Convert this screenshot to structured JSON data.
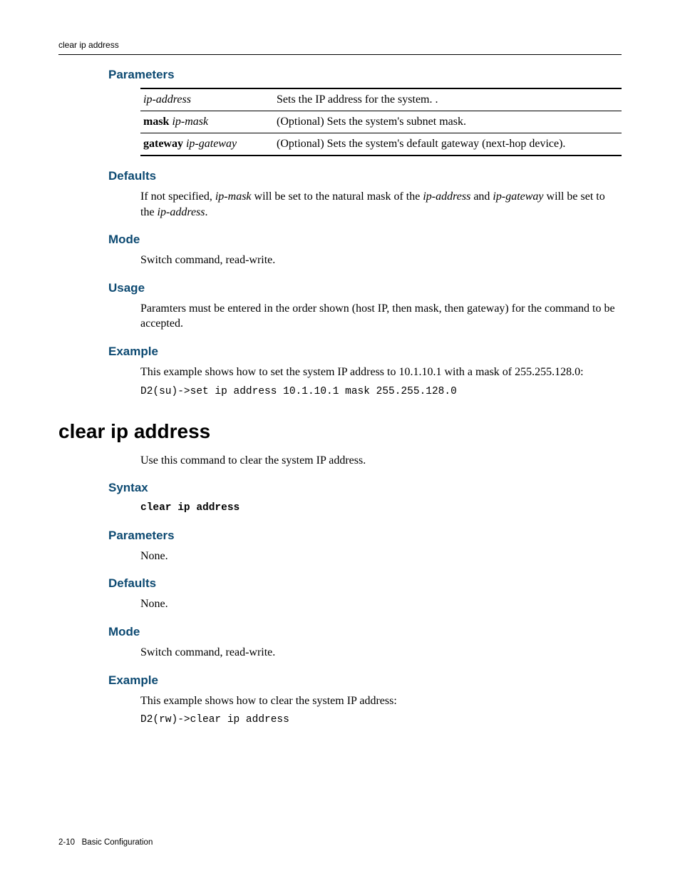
{
  "header": {
    "running": "clear ip address"
  },
  "sec_parameters": {
    "heading": "Parameters",
    "rows": [
      {
        "left_bold": "",
        "left_italic": "ip-address",
        "desc": "Sets the IP address for the system. ."
      },
      {
        "left_bold": "mask",
        "left_italic": "ip-mask",
        "desc": "(Optional) Sets the system's subnet mask."
      },
      {
        "left_bold": "gateway",
        "left_italic": "ip-gateway",
        "desc": "(Optional) Sets the system's default gateway (next-hop device)."
      }
    ]
  },
  "sec_defaults": {
    "heading": "Defaults",
    "pre": "If not specified, ",
    "i1": "ip-mask",
    "mid1": " will be set to the natural mask of the ",
    "i2": "ip-address",
    "mid2": " and ",
    "i3": "ip-gateway",
    "mid3": " will be set to the ",
    "i4": "ip-address",
    "post": "."
  },
  "sec_mode": {
    "heading": "Mode",
    "text": "Switch command, read-write."
  },
  "sec_usage": {
    "heading": "Usage",
    "text": "Paramters must be entered in the order shown (host IP, then mask, then gateway) for the command to be accepted."
  },
  "sec_example": {
    "heading": "Example",
    "text": "This example shows how to set the system IP address to 10.1.10.1 with a mask of 255.255.128.0:",
    "code": "D2(su)->set ip address 10.1.10.1 mask 255.255.128.0"
  },
  "cmd2": {
    "title": "clear ip address",
    "intro": "Use this command to clear the system IP address.",
    "syntax_heading": "Syntax",
    "syntax_code": "clear ip address",
    "parameters_heading": "Parameters",
    "parameters_text": "None.",
    "defaults_heading": "Defaults",
    "defaults_text": "None.",
    "mode_heading": "Mode",
    "mode_text": "Switch command, read-write.",
    "example_heading": "Example",
    "example_text": "This example shows how to clear the system IP address:",
    "example_code": "D2(rw)->clear ip address"
  },
  "footer": {
    "page": "2-10",
    "title": "Basic Configuration"
  }
}
